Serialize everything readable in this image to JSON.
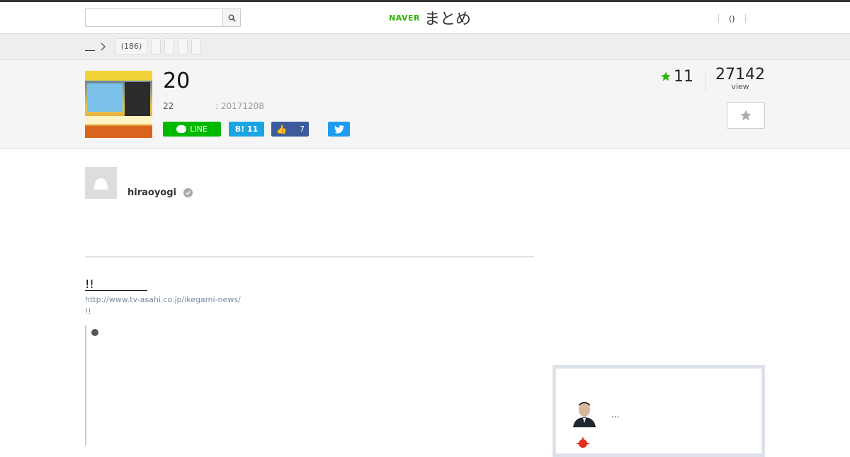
{
  "header": {
    "search": {
      "placeholder": "",
      "value": ""
    },
    "logo": {
      "naver": "NAVER",
      "matome": "まとめ"
    },
    "nav": {
      "link": "()"
    }
  },
  "breadcrumb": {
    "tags": [
      "(186)",
      "",
      "",
      "",
      ""
    ]
  },
  "article": {
    "title": "20",
    "meta_count": "22",
    "meta_date": ": 20171208",
    "share": {
      "line": "LINE",
      "hatena": "11",
      "like": "7"
    },
    "favorites": "11",
    "views": "27142",
    "views_label": "view"
  },
  "author": {
    "name": "hiraoyogi"
  },
  "link": {
    "title": "!!",
    "url": "http://www.tv-asahi.co.jp/ikegami-news/",
    "desc": "!!"
  },
  "sidebar": {
    "text": "..."
  },
  "colors": {
    "naver_green": "#2db400",
    "line_green": "#00b900",
    "hatena_blue": "#1ba4e2",
    "facebook_blue": "#3b5b9c",
    "twitter_blue": "#1d9bf0"
  }
}
